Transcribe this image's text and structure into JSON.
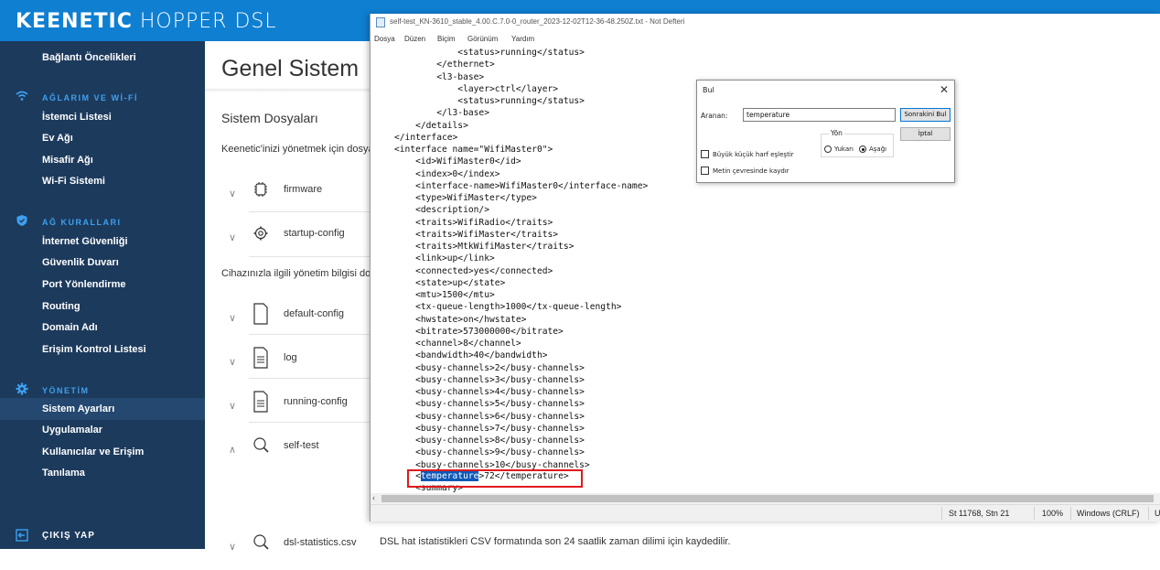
{
  "brand": {
    "logo_bold": "KEENETIC",
    "logo_light": "HOPPER DSL"
  },
  "sidebar": {
    "top_item": "Bağlantı Öncelikleri",
    "sections": [
      {
        "title": "AĞLARIM VE Wİ-Fİ",
        "icon": "wifi-icon",
        "items": [
          "İstemci Listesi",
          "Ev Ağı",
          "Misafir Ağı",
          "Wi-Fi Sistemi"
        ]
      },
      {
        "title": "AĞ KURALLARI",
        "icon": "shield-icon",
        "items": [
          "İnternet Güvenliği",
          "Güvenlik Duvarı",
          "Port Yönlendirme",
          "Routing",
          "Domain Adı",
          "Erişim Kontrol Listesi"
        ]
      },
      {
        "title": "YÖNETİM",
        "icon": "gear-icon",
        "items": [
          "Sistem Ayarları",
          "Uygulamalar",
          "Kullanıcılar ve Erişim",
          "Tanılama"
        ]
      }
    ],
    "active_item": "Sistem Ayarları",
    "logout": "ÇIKIŞ YAP"
  },
  "main": {
    "title": "Genel Sistem",
    "section_title": "Sistem Dosyaları",
    "desc1": "Keenetic'inizi yönetmek için dosyala",
    "desc2": "Cihazınızla ilgili yönetim bilgisi dosy",
    "files": [
      "firmware",
      "startup-config",
      "default-config",
      "log",
      "running-config",
      "self-test",
      "dsl-statistics.csv"
    ],
    "bottom_desc": "DSL hat istatistikleri CSV formatında son 24 saatlik zaman dilimi için kaydedilir."
  },
  "notepad": {
    "title": "self-test_KN-3610_stable_4.00.C.7.0-0_router_2023-12-02T12-36-48.250Z.txt - Not Defteri",
    "menu": [
      "Dosya",
      "Düzen",
      "Biçim",
      "Görünüm",
      "Yardım"
    ],
    "lines": [
      "            <status>running</status>",
      "        </ethernet>",
      "        <l3-base>",
      "            <layer>ctrl</layer>",
      "            <status>running</status>",
      "        </l3-base>",
      "    </details>",
      "</interface>",
      "<interface name=\"WifiMaster0\">",
      "    <id>WifiMaster0</id>",
      "    <index>0</index>",
      "    <interface-name>WifiMaster0</interface-name>",
      "    <type>WifiMaster</type>",
      "    <description/>",
      "    <traits>WifiRadio</traits>",
      "    <traits>WifiMaster</traits>",
      "    <traits>MtkWifiMaster</traits>",
      "    <link>up</link>",
      "    <connected>yes</connected>",
      "    <state>up</state>",
      "    <mtu>1500</mtu>",
      "    <tx-queue-length>1000</tx-queue-length>",
      "    <hwstate>on</hwstate>",
      "    <bitrate>573000000</bitrate>",
      "    <channel>8</channel>",
      "    <bandwidth>40</bandwidth>",
      "    <busy-channels>2</busy-channels>",
      "    <busy-channels>3</busy-channels>",
      "    <busy-channels>4</busy-channels>",
      "    <busy-channels>5</busy-channels>",
      "    <busy-channels>6</busy-channels>",
      "    <busy-channels>7</busy-channels>",
      "    <busy-channels>8</busy-channels>",
      "    <busy-channels>9</busy-channels>",
      "    <busy-channels>10</busy-channels>"
    ],
    "highlight_line": {
      "prefix": "    <",
      "selected": "temperature",
      "suffix": ">72</temperature>"
    },
    "last_line": "    <summary>",
    "status": {
      "position": "St 11768, Stn 21",
      "zoom": "100%",
      "line_ending": "Windows (CRLF)",
      "encoding": "U"
    }
  },
  "find_dialog": {
    "title": "Bul",
    "search_label": "Aranan:",
    "search_value": "temperature",
    "find_next": "Sonrakini Bul",
    "cancel": "İptal",
    "direction_label": "Yön",
    "up": "Yukarı",
    "down": "Aşağı",
    "match_case": "Büyük küçük harf eşleştir",
    "wrap": "Metin çevresinde kaydır"
  },
  "colors": {
    "topbar": "#0f7fd1",
    "sidebar": "#1c3a5c",
    "accent": "#3ea0f0",
    "highlight": "#0d58b8",
    "redbox": "#e0191b"
  }
}
